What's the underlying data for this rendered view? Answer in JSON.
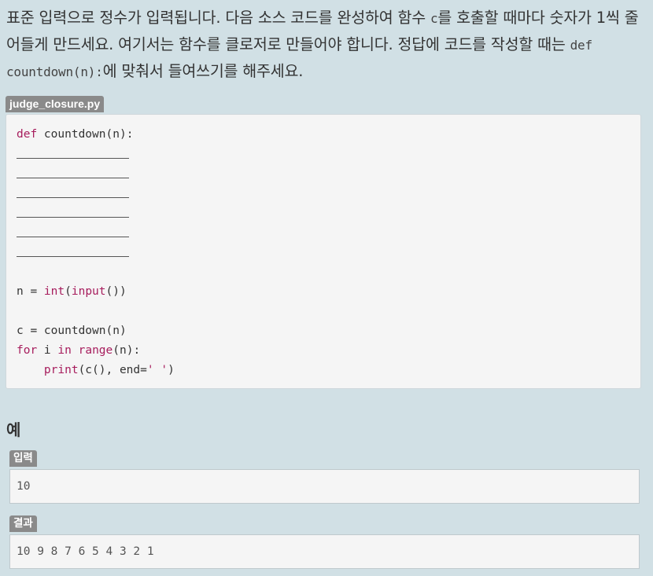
{
  "problem": {
    "part1": "표준 입력으로 정수가 입력됩니다. 다음 소스 코드를 완성하여 함수 ",
    "inline_c": "c",
    "part2": "를 호출할 때마다 숫자가 1씩 줄어들게 만드세요. 여기서는 함수를 클로저로 만들어야 합니다. 정답에 코드를 작성할 때는 ",
    "inline_def": "def countdown(n):",
    "part3": "에 맞춰서 들여쓰기를 해주세요."
  },
  "code": {
    "filename": "judge_closure.py",
    "def_kw": "def",
    "def_rest": " countdown(n):",
    "blank_count": 6,
    "n_prefix": "n = ",
    "int_fn": "int",
    "paren1": "(",
    "input_fn": "input",
    "n_suffix": "())",
    "c_line": "c = countdown(n)",
    "for_kw": "for",
    "for_mid": " i ",
    "in_kw": "in",
    "space": " ",
    "range_fn": "range",
    "for_end": "(n):",
    "indent": "    ",
    "print_fn": "print",
    "print_rest": "(c(), end=",
    "print_str": "' '",
    "print_close": ")"
  },
  "example": {
    "title": "예",
    "input_label": "입력",
    "input_value": "10",
    "output_label": "결과",
    "output_value": "10 9 8 7 6 5 4 3 2 1"
  }
}
